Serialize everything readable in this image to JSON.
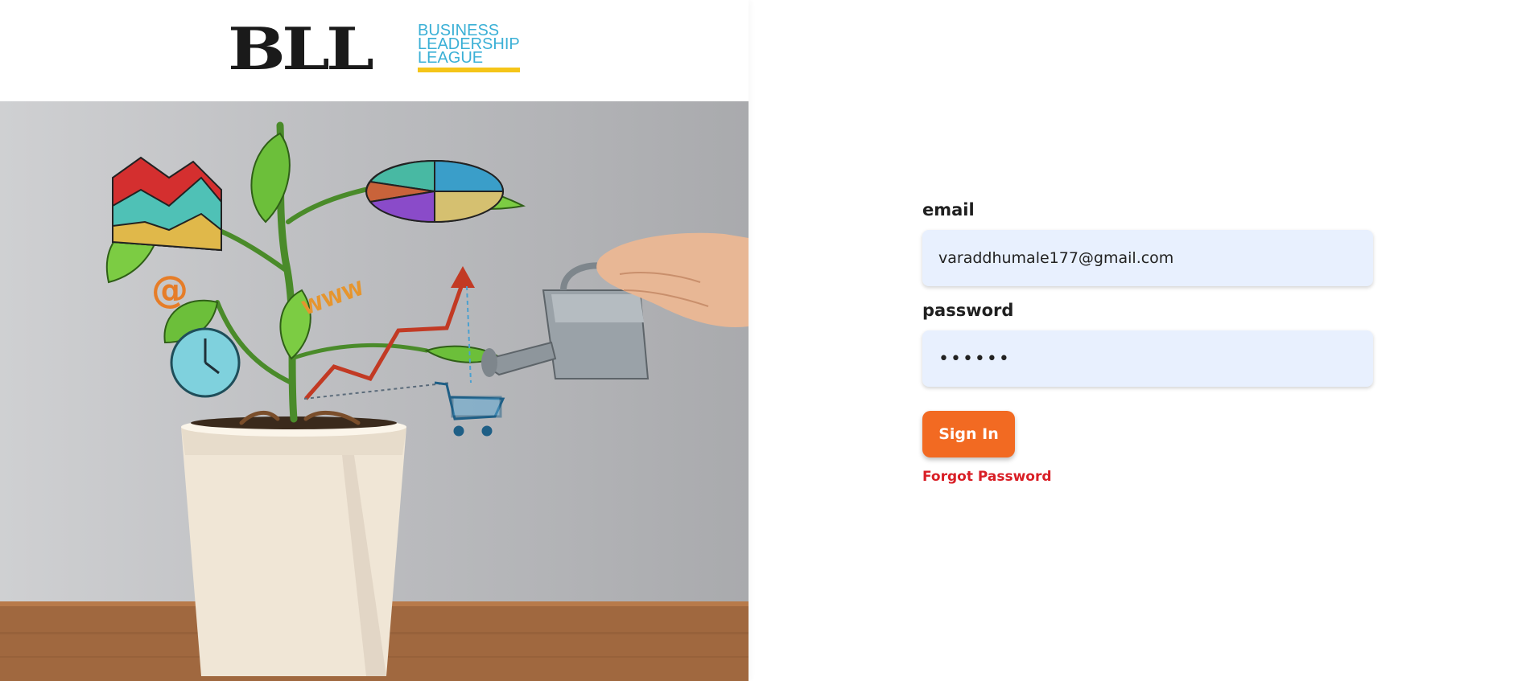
{
  "brand": {
    "logo_mark": "BLL",
    "logo_lines": [
      "BUSINESS",
      "LEADERSHIP",
      "LEAGUE"
    ],
    "logo_text_color": "#3bb0d6",
    "logo_accent_color": "#f5c518"
  },
  "hero_image": {
    "icon_names": [
      "plant-pot-icon",
      "watering-can-icon",
      "pie-chart-icon",
      "area-chart-icon",
      "at-sign-icon",
      "www-icon",
      "clock-icon",
      "trend-arrow-icon",
      "shopping-cart-icon"
    ],
    "at_symbol": "@",
    "www_text": "WWW"
  },
  "login_form": {
    "email_label": "email",
    "email_value": "varaddhumale177@gmail.com",
    "password_label": "password",
    "password_value": "••••••",
    "submit_label": "Sign In",
    "forgot_label": "Forgot Password"
  },
  "colors": {
    "input_background": "#e8f0fe",
    "button_background": "#f26a22",
    "forgot_link": "#d91f26"
  }
}
